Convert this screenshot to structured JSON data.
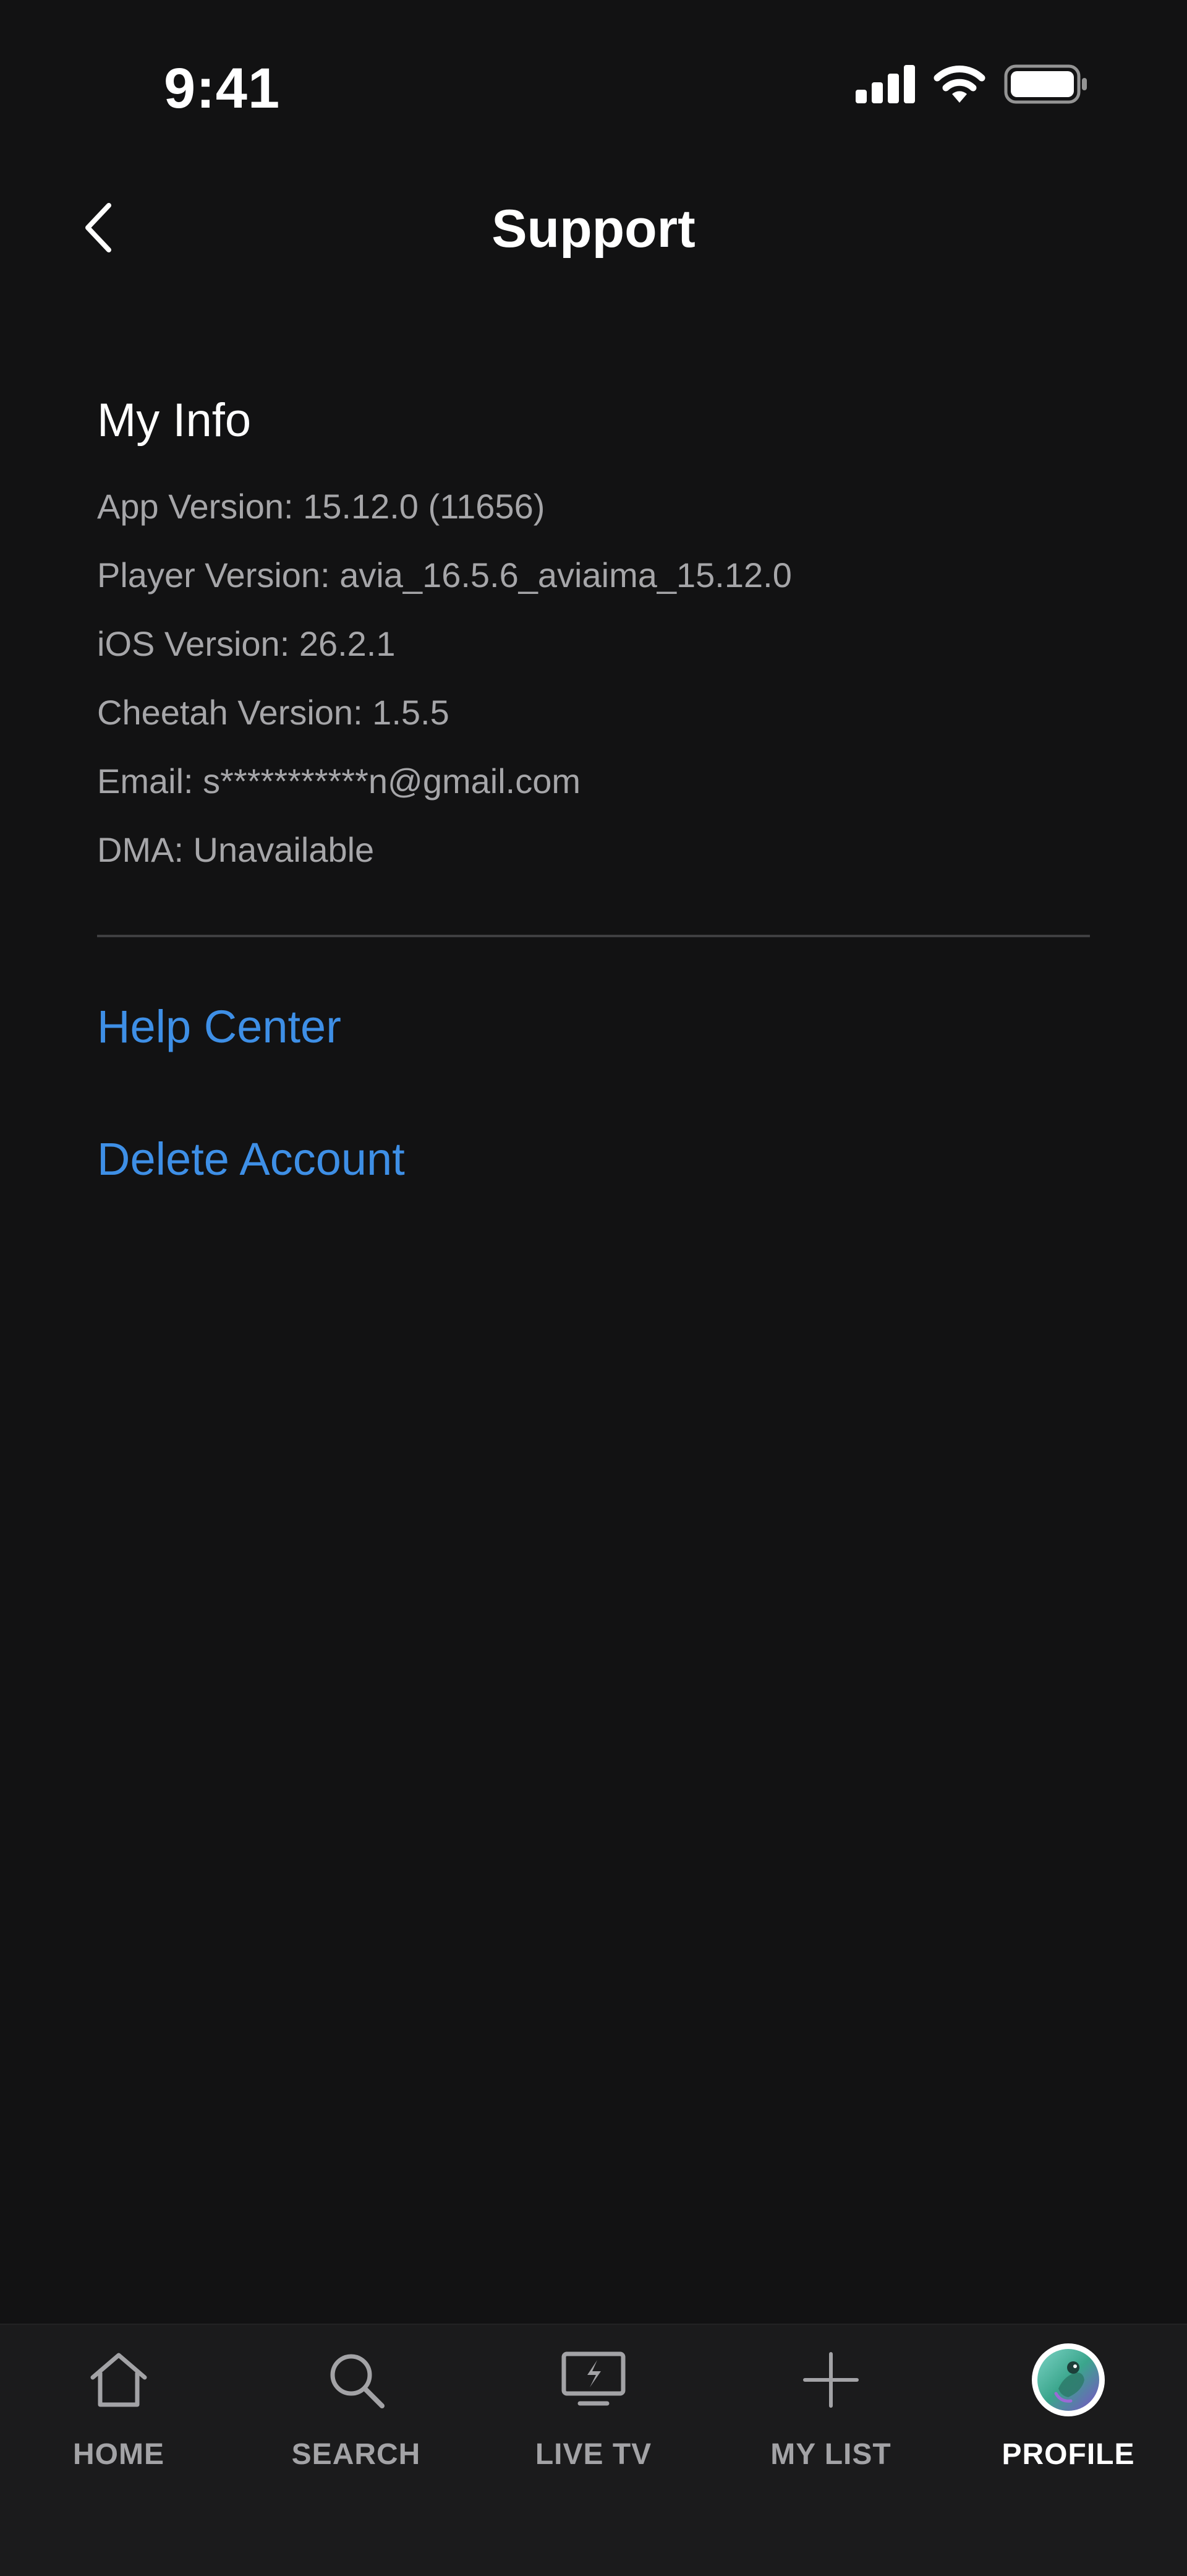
{
  "status_bar": {
    "time": "9:41",
    "icons": [
      "cellular-signal-icon",
      "wifi-icon",
      "battery-icon"
    ]
  },
  "header": {
    "title": "Support",
    "back_icon": "chevron-left-icon"
  },
  "my_info": {
    "heading": "My Info",
    "lines": [
      "App Version: 15.12.0 (11656)",
      "Player Version: avia_16.5.6_aviaima_15.12.0",
      "iOS Version: 26.2.1",
      "Cheetah Version: 1.5.5",
      "Email: s***********n@gmail.com",
      "DMA: Unavailable"
    ]
  },
  "links": {
    "help_center": "Help Center",
    "delete_account": "Delete Account"
  },
  "tab_bar": {
    "tabs": [
      {
        "label": "HOME",
        "icon": "home-icon",
        "active": false
      },
      {
        "label": "SEARCH",
        "icon": "search-icon",
        "active": false
      },
      {
        "label": "LIVE TV",
        "icon": "live-tv-icon",
        "active": false
      },
      {
        "label": "MY LIST",
        "icon": "plus-icon",
        "active": false
      },
      {
        "label": "PROFILE",
        "icon": "profile-avatar-icon",
        "active": true
      }
    ]
  },
  "colors": {
    "background": "#121213",
    "tab_bar_background": "#1b1b1c",
    "link": "#3e8fe6",
    "secondary_text": "#a6a6a9",
    "divider": "#3f3f41"
  }
}
